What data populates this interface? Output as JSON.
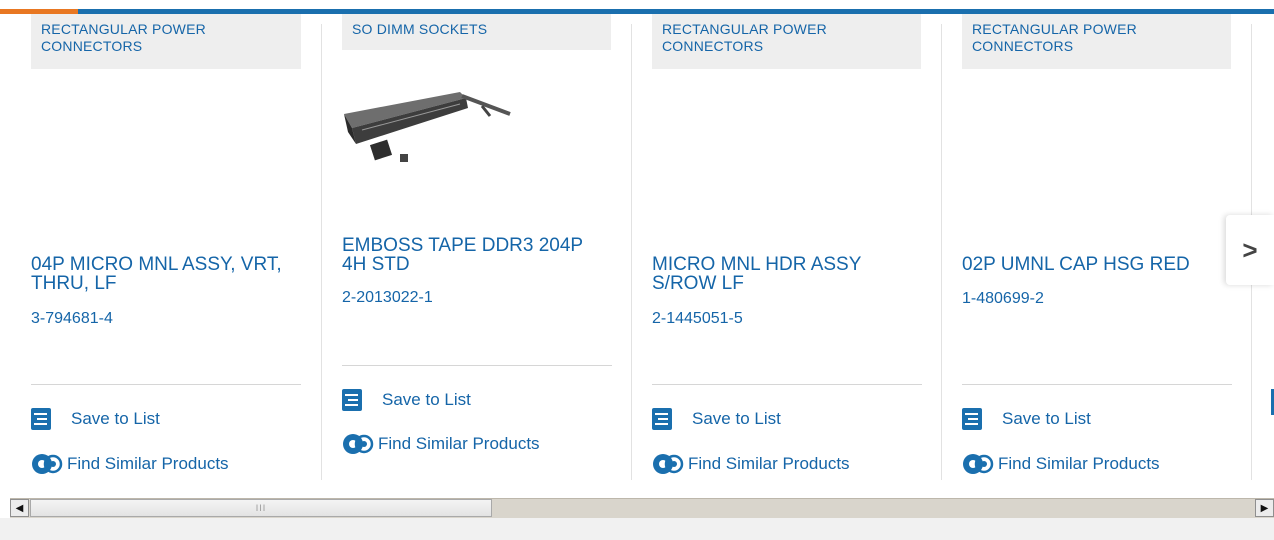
{
  "colors": {
    "brand_blue": "#1a6fae",
    "accent_orange": "#e87722",
    "link_text": "#1565a8"
  },
  "cards": [
    {
      "category": "RECTANGULAR POWER CONNECTORS",
      "title": "04P MICRO MNL ASSY, VRT, THRU, LF",
      "part_number": "3-794681-4",
      "save_label": "Save to List",
      "similar_label": "Find Similar Products"
    },
    {
      "category": "SO DIMM SOCKETS",
      "title": "EMBOSS TAPE DDR3 204P 4H STD",
      "part_number": "2-2013022-1",
      "save_label": "Save to List",
      "similar_label": "Find Similar Products"
    },
    {
      "category": "RECTANGULAR POWER CONNECTORS",
      "title": "MICRO MNL HDR ASSY S/ROW LF",
      "part_number": "2-1445051-5",
      "save_label": "Save to List",
      "similar_label": "Find Similar Products"
    },
    {
      "category": "RECTANGULAR POWER CONNECTORS",
      "title": "02P UMNL CAP HSG RED",
      "part_number": "1-480699-2",
      "save_label": "Save to List",
      "similar_label": "Find Similar Products"
    }
  ],
  "icons": {
    "next": "chevron-right-icon",
    "save": "checklist-icon",
    "similar": "gears-icon",
    "scroll_left": "triangle-left-icon",
    "scroll_right": "triangle-right-icon"
  },
  "next_arrow_glyph": ">",
  "scrollbar": {
    "left_glyph": "◀",
    "right_glyph": "▶",
    "thumb_grip": "III"
  }
}
